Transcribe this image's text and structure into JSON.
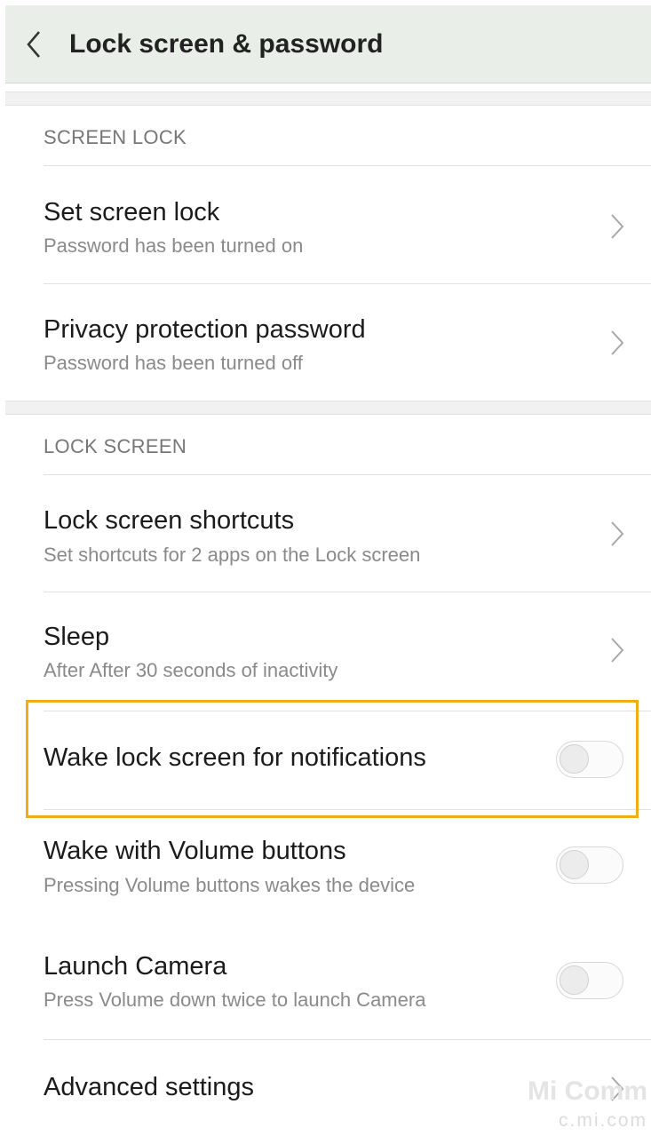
{
  "header": {
    "title": "Lock screen & password"
  },
  "sections": {
    "screen_lock": {
      "label": "SCREEN LOCK",
      "items": [
        {
          "title": "Set screen lock",
          "subtitle": "Password has been turned on"
        },
        {
          "title": "Privacy protection password",
          "subtitle": "Password has been turned off"
        }
      ]
    },
    "lock_screen": {
      "label": "LOCK SCREEN",
      "items": [
        {
          "title": "Lock screen shortcuts",
          "subtitle": "Set shortcuts for 2 apps on the Lock screen"
        },
        {
          "title": "Sleep",
          "subtitle": "After After 30 seconds of inactivity"
        },
        {
          "title": "Wake lock screen for notifications",
          "toggle": "off"
        },
        {
          "title": "Wake with Volume buttons",
          "subtitle": "Pressing Volume buttons wakes the device",
          "toggle": "off"
        },
        {
          "title": "Launch Camera",
          "subtitle": "Press Volume down twice to launch Camera",
          "toggle": "off"
        },
        {
          "title": "Advanced settings"
        }
      ]
    }
  },
  "watermark": {
    "line1": "Mi Comm",
    "line2": "c.mi.com"
  },
  "colors": {
    "highlight": "#f0ad18",
    "header_bg": "#eaeee9"
  },
  "icons": {
    "back": "chevron-left-icon",
    "row_arrow": "chevron-right-icon"
  }
}
